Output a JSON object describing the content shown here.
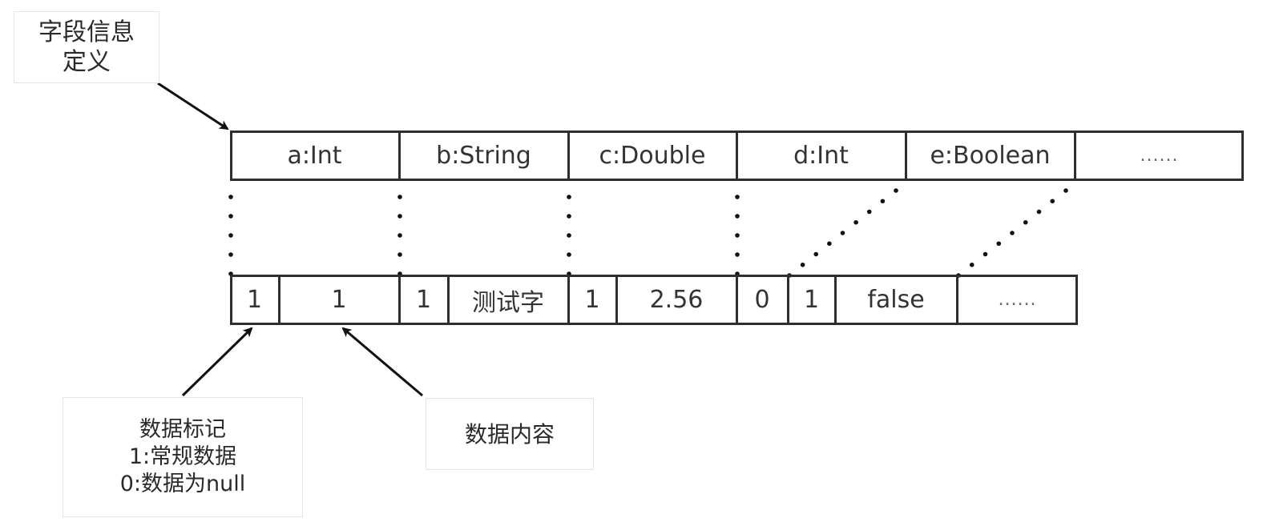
{
  "labels": {
    "field_definition": [
      "字段信息",
      "定义"
    ],
    "data_flag": [
      "数据标记",
      "1:常规数据",
      "0:数据为null"
    ],
    "data_content": [
      "数据内容"
    ]
  },
  "field_row": {
    "cells": [
      {
        "text": "a:Int"
      },
      {
        "text": "b:String"
      },
      {
        "text": "c:Double"
      },
      {
        "text": "d:Int"
      },
      {
        "text": "e:Boolean"
      },
      {
        "text": "......"
      }
    ]
  },
  "data_row": {
    "cells": [
      {
        "text": "1",
        "role": "flag"
      },
      {
        "text": "1",
        "role": "content"
      },
      {
        "text": "1",
        "role": "flag"
      },
      {
        "text": "测试字",
        "role": "content"
      },
      {
        "text": "1",
        "role": "flag"
      },
      {
        "text": "2.56",
        "role": "content"
      },
      {
        "text": "0",
        "role": "flag"
      },
      {
        "text": "1",
        "role": "flag"
      },
      {
        "text": "false",
        "role": "content"
      },
      {
        "text": "......",
        "role": "content"
      }
    ]
  },
  "colors": {
    "stroke": "#2e2e2e",
    "label_border": "#e4e4e4"
  }
}
